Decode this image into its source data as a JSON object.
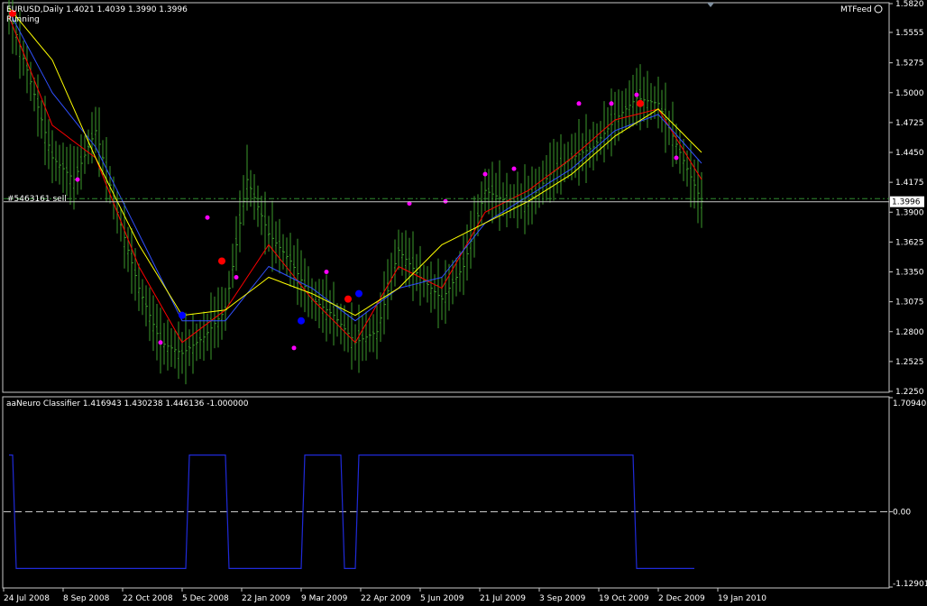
{
  "chart_data": {
    "type": "bar",
    "symbol_header": "EURUSD,Daily  1.4021 1.4039 1.3990 1.3996",
    "status": "Running",
    "feed_label": "MTFeed",
    "order_label": "#5463161 sell",
    "price_axis": {
      "ticks": [
        "1.5820",
        "1.5555",
        "1.5275",
        "1.5000",
        "1.4725",
        "1.4450",
        "1.4175",
        "1.3900",
        "1.3625",
        "1.3350",
        "1.3075",
        "1.2800",
        "1.2525",
        "1.2250"
      ],
      "ylim": [
        1.225,
        1.582
      ],
      "current_price": "1.3996",
      "order_line": 1.4025
    },
    "time_axis": {
      "ticks": [
        "24 Jul 2008",
        "8 Sep 2008",
        "22 Oct 2008",
        "5 Dec 2008",
        "22 Jan 2009",
        "9 Mar 2009",
        "22 Apr 2009",
        "5 Jun 2009",
        "21 Jul 2009",
        "3 Sep 2009",
        "19 Oct 2009",
        "2 Dec 2009",
        "19 Jan 2010"
      ]
    },
    "price_series": {
      "name": "EURUSD",
      "x": [
        0,
        6,
        12,
        18,
        24,
        30,
        36,
        42,
        48,
        54,
        60,
        66,
        72,
        78,
        84,
        90,
        96,
        102,
        108,
        114,
        120,
        126,
        132,
        138,
        144,
        150,
        156,
        162,
        168,
        174,
        180,
        186,
        192
      ],
      "close": [
        1.575,
        1.51,
        1.44,
        1.42,
        1.465,
        1.39,
        1.32,
        1.27,
        1.26,
        1.275,
        1.3,
        1.42,
        1.37,
        1.345,
        1.31,
        1.295,
        1.27,
        1.28,
        1.355,
        1.33,
        1.31,
        1.34,
        1.41,
        1.4,
        1.4,
        1.425,
        1.44,
        1.45,
        1.475,
        1.495,
        1.49,
        1.445,
        1.4
      ]
    },
    "moving_averages": [
      {
        "color": "#ff0000",
        "x": [
          0,
          12,
          24,
          36,
          48,
          60,
          72,
          84,
          96,
          108,
          120,
          132,
          144,
          156,
          168,
          180,
          192
        ],
        "values": [
          1.57,
          1.47,
          1.44,
          1.34,
          1.27,
          1.3,
          1.36,
          1.31,
          1.27,
          1.34,
          1.32,
          1.39,
          1.41,
          1.44,
          1.475,
          1.485,
          1.42
        ]
      },
      {
        "color": "#3050ff",
        "x": [
          0,
          12,
          24,
          36,
          48,
          60,
          72,
          84,
          96,
          108,
          120,
          132,
          144,
          156,
          168,
          180,
          192
        ],
        "values": [
          1.575,
          1.5,
          1.45,
          1.37,
          1.29,
          1.29,
          1.34,
          1.32,
          1.29,
          1.32,
          1.33,
          1.38,
          1.405,
          1.43,
          1.465,
          1.48,
          1.435
        ]
      },
      {
        "color": "#ffff00",
        "x": [
          0,
          12,
          24,
          36,
          48,
          60,
          72,
          84,
          96,
          108,
          120,
          132,
          144,
          156,
          168,
          180,
          192
        ],
        "values": [
          1.578,
          1.53,
          1.44,
          1.36,
          1.295,
          1.3,
          1.33,
          1.315,
          1.295,
          1.32,
          1.36,
          1.38,
          1.4,
          1.425,
          1.46,
          1.485,
          1.445
        ]
      }
    ],
    "signal_markers": [
      {
        "x": 1,
        "y": 1.573,
        "color": "#ff0000",
        "big": true
      },
      {
        "x": 19,
        "y": 1.42,
        "color": "#ff00ff",
        "big": false
      },
      {
        "x": 42,
        "y": 1.27,
        "color": "#ff00ff",
        "big": false
      },
      {
        "x": 48,
        "y": 1.295,
        "color": "#0000ff",
        "big": true
      },
      {
        "x": 55,
        "y": 1.385,
        "color": "#ff00ff",
        "big": false
      },
      {
        "x": 59,
        "y": 1.345,
        "color": "#ff0000",
        "big": true
      },
      {
        "x": 63,
        "y": 1.33,
        "color": "#ff00ff",
        "big": false
      },
      {
        "x": 79,
        "y": 1.265,
        "color": "#ff00ff",
        "big": false
      },
      {
        "x": 81,
        "y": 1.29,
        "color": "#0000ff",
        "big": true
      },
      {
        "x": 88,
        "y": 1.335,
        "color": "#ff00ff",
        "big": false
      },
      {
        "x": 94,
        "y": 1.31,
        "color": "#ff0000",
        "big": true
      },
      {
        "x": 97,
        "y": 1.315,
        "color": "#0000ff",
        "big": true
      },
      {
        "x": 111,
        "y": 1.398,
        "color": "#ff00ff",
        "big": false
      },
      {
        "x": 121,
        "y": 1.4,
        "color": "#ff00ff",
        "big": false
      },
      {
        "x": 132,
        "y": 1.425,
        "color": "#ff00ff",
        "big": false
      },
      {
        "x": 140,
        "y": 1.43,
        "color": "#ff00ff",
        "big": false
      },
      {
        "x": 158,
        "y": 1.49,
        "color": "#ff00ff",
        "big": false
      },
      {
        "x": 167,
        "y": 1.49,
        "color": "#ff00ff",
        "big": false
      },
      {
        "x": 174,
        "y": 1.498,
        "color": "#ff00ff",
        "big": false
      },
      {
        "x": 175,
        "y": 1.49,
        "color": "#ff0000",
        "big": true
      },
      {
        "x": 185,
        "y": 1.44,
        "color": "#ff00ff",
        "big": false
      }
    ],
    "indicator": {
      "title": "aaNeuro Classifier 1.416943 1.430238 1.446136 -1.000000",
      "ticks": [
        "1.709405",
        "0.00",
        "-1.12901"
      ],
      "ylim": [
        -1.129,
        1.709
      ],
      "zero_line": 0,
      "x": [
        0,
        1,
        2,
        49,
        50,
        60,
        61,
        81,
        82,
        92,
        93,
        96,
        97,
        173,
        174,
        190
      ],
      "values": [
        1,
        1,
        -1,
        -1,
        1,
        1,
        -1,
        -1,
        1,
        1,
        -1,
        -1,
        1,
        1,
        -1,
        -1
      ]
    }
  }
}
